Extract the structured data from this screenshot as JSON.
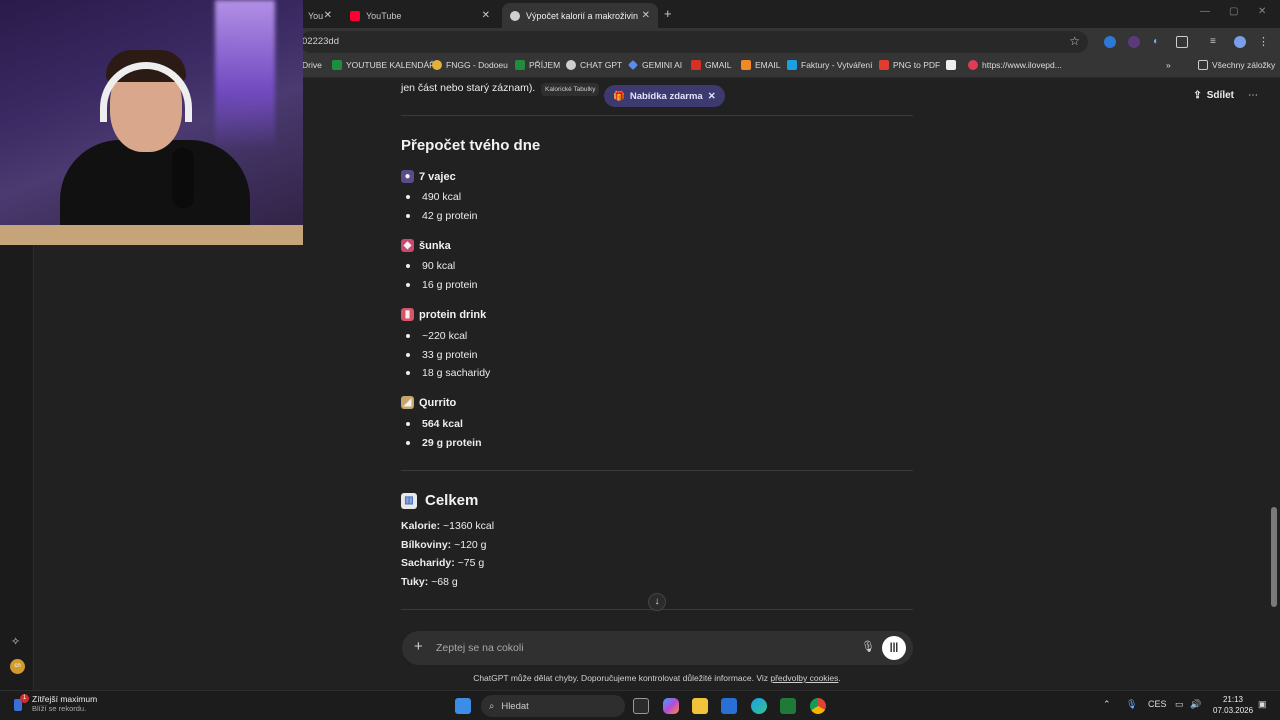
{
  "browser": {
    "tabs": [
      {
        "title": "You"
      },
      {
        "title": "YouTube"
      },
      {
        "title": "Výpočet kalorií a makroživin"
      }
    ],
    "address": "02223dd",
    "bookmarks": [
      "Drive",
      "YOUTUBE KALENDÁŘ",
      "FNGG - Dodoeu",
      "PŘÍJEM",
      "CHAT GPT",
      "GEMINI AI",
      "GMAIL",
      "EMAIL",
      "Faktury - Vytváření",
      "PNG to PDF",
      "https://www.ilovepd...",
      "Všechny záložky"
    ]
  },
  "chat": {
    "top_actions": {
      "share": "Sdílet"
    },
    "prev_line": "jen část nebo starý záznam).",
    "small_chip": "Kalorické Tabulky",
    "offer_chip": "Nabídka zdarma",
    "section_title": "Přepočet tvého dne",
    "items": [
      {
        "name": "7 vajec",
        "emoji": "egg-icon",
        "lines": [
          "490 kcal",
          "42 g protein"
        ],
        "bold": false
      },
      {
        "name": "šunka",
        "emoji": "ham-icon",
        "lines": [
          "90 kcal",
          "16 g protein"
        ],
        "bold": false
      },
      {
        "name": "protein drink",
        "emoji": "drink-icon",
        "lines": [
          "~220 kcal",
          "33 g protein",
          "18 g sacharidy"
        ],
        "bold": false
      },
      {
        "name": "Qurrito",
        "emoji": "burrito-icon",
        "lines": [
          "564 kcal",
          "29 g protein"
        ],
        "bold": true
      }
    ],
    "summary": {
      "title": "Celkem",
      "rows": [
        {
          "label": "Kalorie:",
          "value": "~1360 kcal"
        },
        {
          "label": "Bílkoviny:",
          "value": "~120 g"
        },
        {
          "label": "Sacharidy:",
          "value": "~75 g"
        },
        {
          "label": "Tuky:",
          "value": "~68 g"
        }
      ]
    },
    "composer_placeholder": "Zeptej se na cokoli",
    "disclaimer": "ChatGPT může dělat chyby. Doporučujeme kontrolovat důležité informace. Viz",
    "disclaimer_link": "předvolby cookies",
    "disclaimer_end": "."
  },
  "taskbar": {
    "weather_title": "Zítřejší maximum",
    "weather_sub": "Blíží se rekordu.",
    "weather_badge": "1",
    "search": "Hledat",
    "lang": "CES",
    "time": "21:13",
    "date": "07.03.2026"
  },
  "rail_avatar": "cn",
  "colors": {
    "accent_chip": "#3c3a6e",
    "page_bg": "#212121"
  }
}
